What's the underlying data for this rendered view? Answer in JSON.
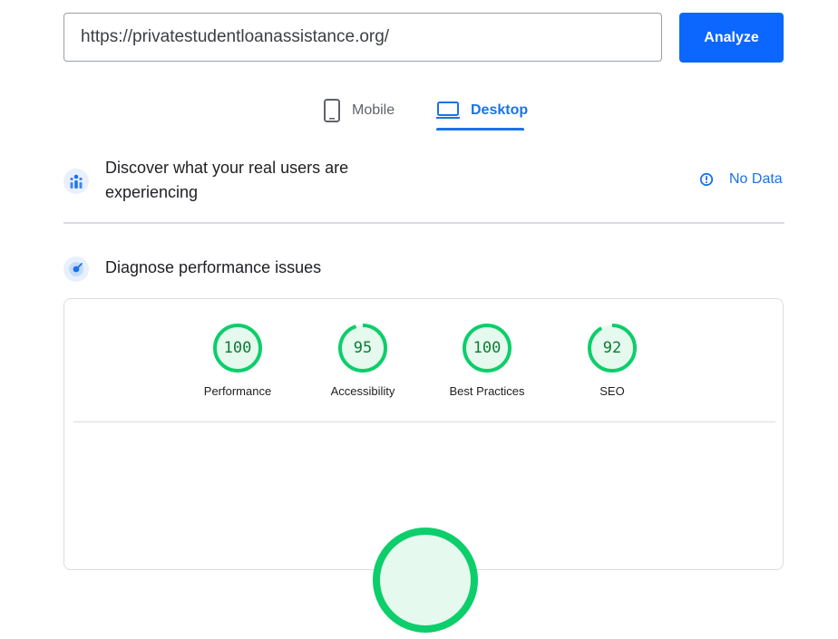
{
  "search": {
    "url": "https://privatestudentloanassistance.org/",
    "analyze_label": "Analyze"
  },
  "tabs": [
    {
      "label": "Mobile",
      "icon": "smartphone-icon",
      "active": false
    },
    {
      "label": "Desktop",
      "icon": "laptop-icon",
      "active": true
    }
  ],
  "crux": {
    "title": "Discover what your real users are experiencing",
    "status": "No Data"
  },
  "diagnose": {
    "title": "Diagnose performance issues"
  },
  "scores": [
    {
      "label": "Performance",
      "value": 100
    },
    {
      "label": "Accessibility",
      "value": 95
    },
    {
      "label": "Best Practices",
      "value": 100
    },
    {
      "label": "SEO",
      "value": 92
    }
  ],
  "colors": {
    "accent": "#1a73e8",
    "button": "#0b67ff",
    "pass": "#0cce6b",
    "pass_text": "#0a7d33",
    "pass_fill": "#e6f9ee"
  }
}
